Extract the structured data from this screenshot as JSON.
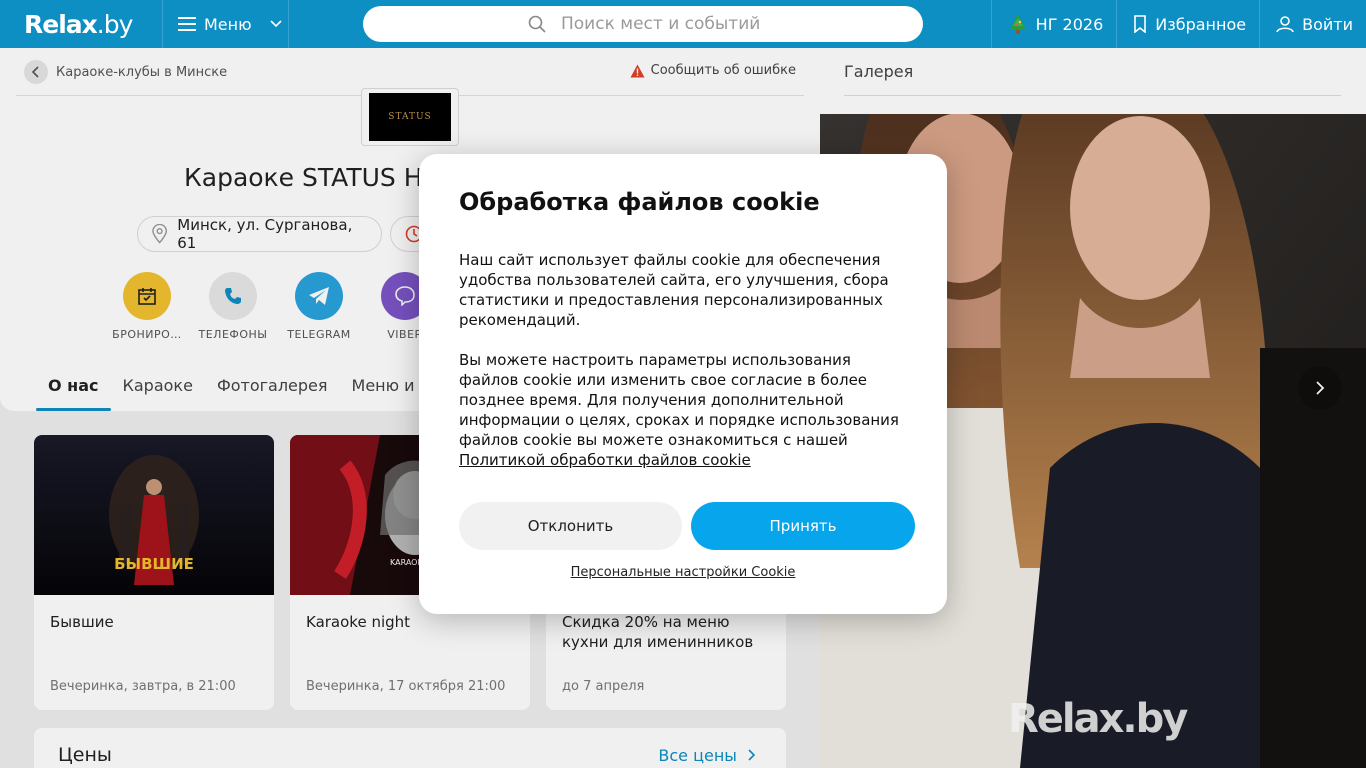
{
  "header": {
    "logo_main": "Relax",
    "logo_dot": ".by",
    "menu_label": "Меню",
    "search_placeholder": "Поиск мест и событий",
    "ng_label": "НГ 2026",
    "favorites_label": "Избранное",
    "login_label": "Войти"
  },
  "venue": {
    "breadcrumb": "Караоке-клубы в Минске",
    "report_label": "Сообщить об ошибке",
    "logo_text": "STATUS",
    "title": "Караоке STATUS HALL",
    "address": "Минск, ул. Сурганова, 61",
    "actions": [
      {
        "label": "БРОНИРО…",
        "color": "#f5c518"
      },
      {
        "label": "ТЕЛЕФОНЫ",
        "color": "#e8e8e8"
      },
      {
        "label": "TELEGRAM",
        "color": "#2aa3df"
      },
      {
        "label": "VIBER",
        "color": "#7d56c9"
      }
    ],
    "tabs": [
      "О нас",
      "Караоке",
      "Фотогалерея",
      "Меню и Цены"
    ]
  },
  "events": [
    {
      "title": "Бывшие",
      "meta": "Вечеринка, завтра, в 21:00",
      "poster_text": "БЫВШИЕ"
    },
    {
      "title": "Karaoke night",
      "meta": "Вечеринка, 17 октября 21:00",
      "poster_text": "KARAOKE"
    },
    {
      "title": "Скидка 20% на меню кухни для именинников",
      "meta": "до 7 апреля",
      "poster_text": ""
    }
  ],
  "prices": {
    "title": "Цены",
    "link": "Все цены"
  },
  "gallery": {
    "title": "Галерея",
    "watermark": "Relax.by"
  },
  "cookie": {
    "title": "Обработка файлов cookie",
    "p1": "Наш сайт использует файлы cookie для обеспечения удобства пользователей сайта, его улучшения, сбора статистики и предоставления персонализированных рекомендаций.",
    "p2": "Вы можете настроить параметры использования файлов cookie или изменить свое согласие в более позднее время. Для получения дополнительной информации о целях, сроках и порядке использования файлов cookie вы можете ознакомиться с нашей",
    "policy_link": "Политикой обработки файлов cookie",
    "decline": "Отклонить",
    "accept": "Принять",
    "personal": "Персональные настройки Cookie"
  },
  "colors": {
    "brand": "#0d8fc4",
    "accept": "#07a5ec"
  }
}
